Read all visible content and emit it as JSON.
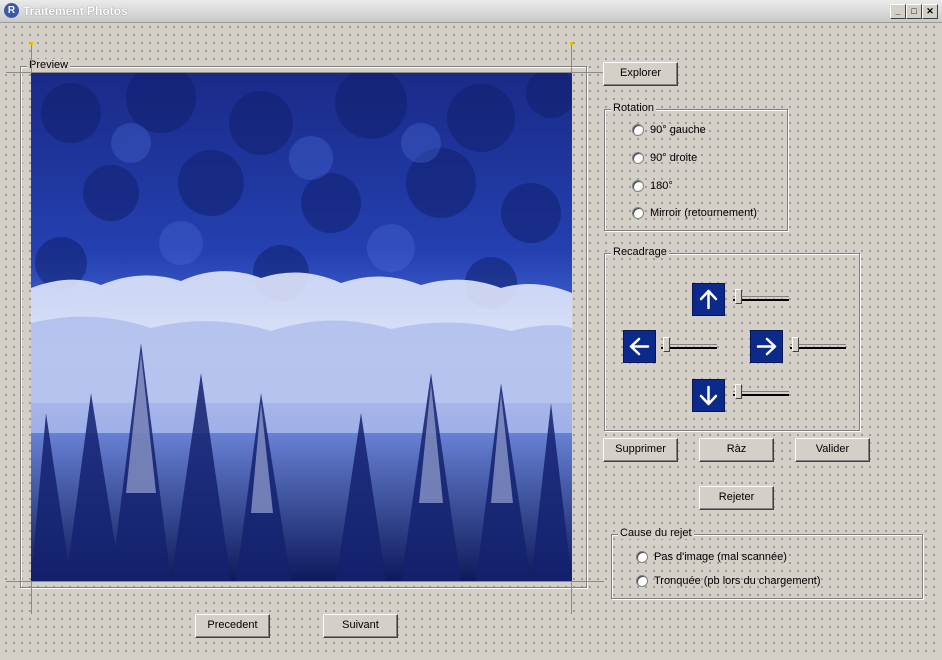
{
  "window": {
    "title": "Traitement Photos",
    "minimize_glyph": "_",
    "maximize_glyph": "□",
    "close_glyph": "✕",
    "icon_letter": "R"
  },
  "preview": {
    "label": "Preview",
    "image_icon": "winter-forest-photo"
  },
  "buttons": {
    "explorer": "Explorer",
    "supprimer": "Supprimer",
    "raz": "Ràz",
    "valider": "Valider",
    "rejeter": "Rejeter",
    "precedent": "Precedent",
    "suivant": "Suivant"
  },
  "rotation": {
    "label": "Rotation",
    "options": [
      "90° gauche",
      "90° droite",
      "180°",
      "Mirroir (retournement)"
    ]
  },
  "recadrage": {
    "label": "Recadrage",
    "controls": [
      {
        "direction": "up",
        "icon": "arrow-up-icon",
        "value": 0
      },
      {
        "direction": "left",
        "icon": "arrow-left-icon",
        "value": 0
      },
      {
        "direction": "right",
        "icon": "arrow-right-icon",
        "value": 0
      },
      {
        "direction": "down",
        "icon": "arrow-down-icon",
        "value": 0
      }
    ],
    "arrow_color": "#0b2a8c"
  },
  "rejet": {
    "label": "Cause du rejet",
    "options": [
      "Pas d'image (mal scannée)",
      "Tronquée (pb lors du chargement)"
    ]
  }
}
